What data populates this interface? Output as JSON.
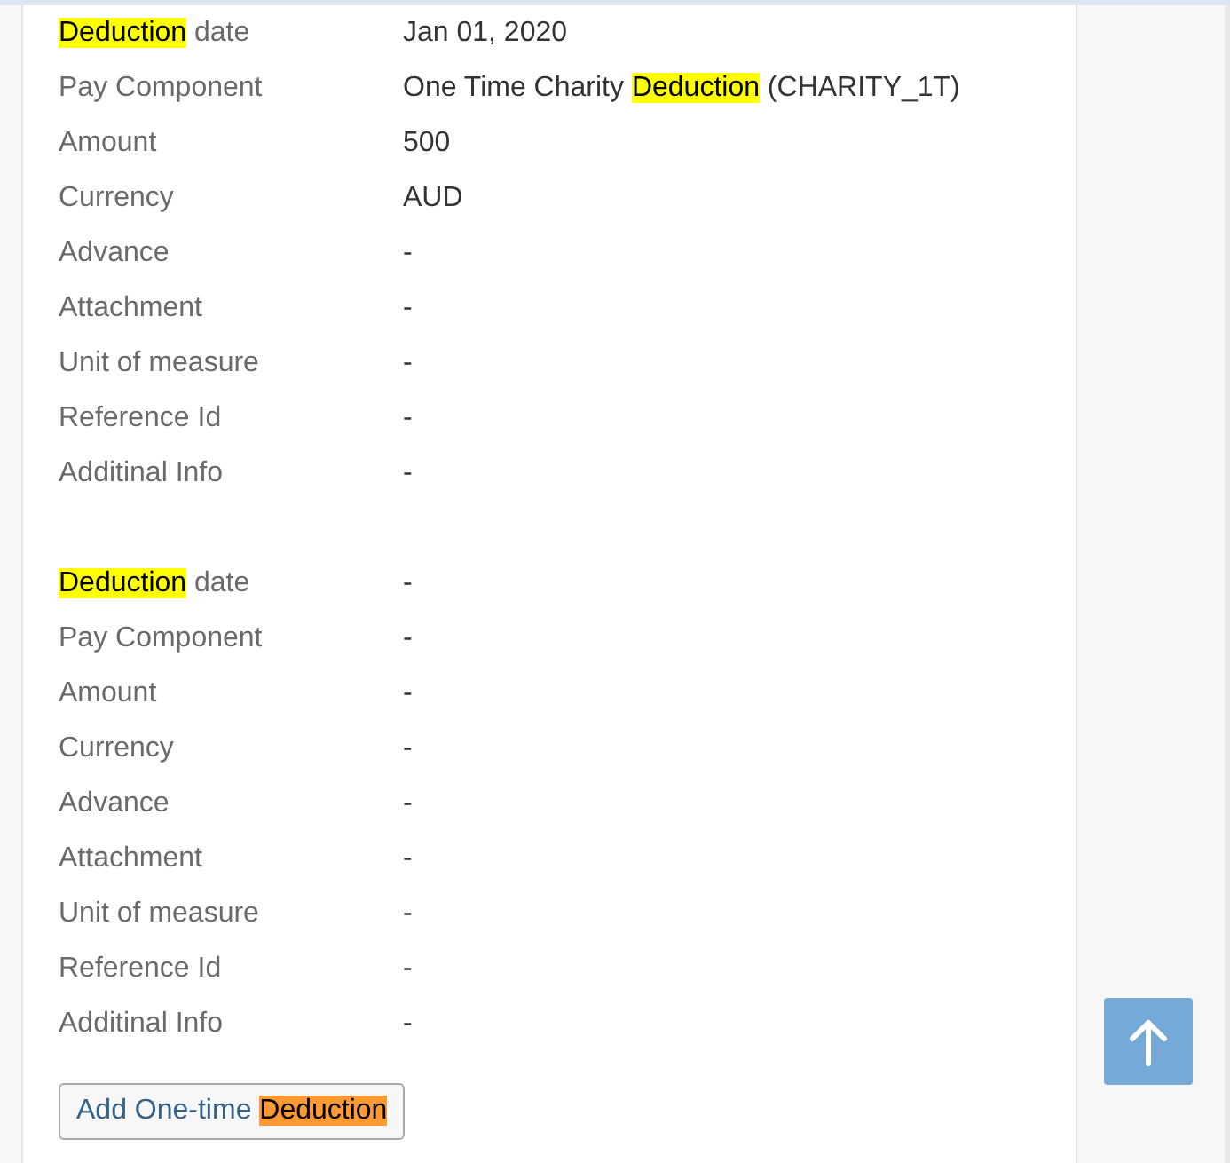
{
  "sections": [
    {
      "fields": [
        {
          "label": [
            {
              "text": "Deduction",
              "highlighted": true,
              "current": false
            },
            {
              "text": " date",
              "highlighted": false,
              "current": false
            }
          ],
          "value": [
            {
              "text": "Jan 01, 2020",
              "highlighted": false,
              "current": false
            }
          ]
        },
        {
          "label": [
            {
              "text": "Pay Component",
              "highlighted": false,
              "current": false
            }
          ],
          "value": [
            {
              "text": "One Time Charity ",
              "highlighted": false,
              "current": false
            },
            {
              "text": "Deduction",
              "highlighted": true,
              "current": false
            },
            {
              "text": " (CHARITY_1T)",
              "highlighted": false,
              "current": false
            }
          ]
        },
        {
          "label": [
            {
              "text": "Amount",
              "highlighted": false,
              "current": false
            }
          ],
          "value": [
            {
              "text": "500",
              "highlighted": false,
              "current": false
            }
          ]
        },
        {
          "label": [
            {
              "text": "Currency",
              "highlighted": false,
              "current": false
            }
          ],
          "value": [
            {
              "text": "AUD",
              "highlighted": false,
              "current": false
            }
          ]
        },
        {
          "label": [
            {
              "text": "Advance",
              "highlighted": false,
              "current": false
            }
          ],
          "value": [
            {
              "text": "-",
              "highlighted": false,
              "current": false
            }
          ]
        },
        {
          "label": [
            {
              "text": "Attachment",
              "highlighted": false,
              "current": false
            }
          ],
          "value": [
            {
              "text": "-",
              "highlighted": false,
              "current": false
            }
          ]
        },
        {
          "label": [
            {
              "text": "Unit of measure",
              "highlighted": false,
              "current": false
            }
          ],
          "value": [
            {
              "text": "-",
              "highlighted": false,
              "current": false
            }
          ]
        },
        {
          "label": [
            {
              "text": "Reference Id",
              "highlighted": false,
              "current": false
            }
          ],
          "value": [
            {
              "text": "-",
              "highlighted": false,
              "current": false
            }
          ]
        },
        {
          "label": [
            {
              "text": "Additinal Info",
              "highlighted": false,
              "current": false
            }
          ],
          "value": [
            {
              "text": "-",
              "highlighted": false,
              "current": false
            }
          ]
        }
      ]
    },
    {
      "fields": [
        {
          "label": [
            {
              "text": "Deduction",
              "highlighted": true,
              "current": false
            },
            {
              "text": " date",
              "highlighted": false,
              "current": false
            }
          ],
          "value": [
            {
              "text": "-",
              "highlighted": false,
              "current": false
            }
          ]
        },
        {
          "label": [
            {
              "text": "Pay Component",
              "highlighted": false,
              "current": false
            }
          ],
          "value": [
            {
              "text": "-",
              "highlighted": false,
              "current": false
            }
          ]
        },
        {
          "label": [
            {
              "text": "Amount",
              "highlighted": false,
              "current": false
            }
          ],
          "value": [
            {
              "text": "-",
              "highlighted": false,
              "current": false
            }
          ]
        },
        {
          "label": [
            {
              "text": "Currency",
              "highlighted": false,
              "current": false
            }
          ],
          "value": [
            {
              "text": "-",
              "highlighted": false,
              "current": false
            }
          ]
        },
        {
          "label": [
            {
              "text": "Advance",
              "highlighted": false,
              "current": false
            }
          ],
          "value": [
            {
              "text": "-",
              "highlighted": false,
              "current": false
            }
          ]
        },
        {
          "label": [
            {
              "text": "Attachment",
              "highlighted": false,
              "current": false
            }
          ],
          "value": [
            {
              "text": "-",
              "highlighted": false,
              "current": false
            }
          ]
        },
        {
          "label": [
            {
              "text": "Unit of measure",
              "highlighted": false,
              "current": false
            }
          ],
          "value": [
            {
              "text": "-",
              "highlighted": false,
              "current": false
            }
          ]
        },
        {
          "label": [
            {
              "text": "Reference Id",
              "highlighted": false,
              "current": false
            }
          ],
          "value": [
            {
              "text": "-",
              "highlighted": false,
              "current": false
            }
          ]
        },
        {
          "label": [
            {
              "text": "Additinal Info",
              "highlighted": false,
              "current": false
            }
          ],
          "value": [
            {
              "text": "-",
              "highlighted": false,
              "current": false
            }
          ]
        }
      ]
    }
  ],
  "add_button": {
    "label": [
      {
        "text": "Add One-time ",
        "highlighted": false,
        "current": false
      },
      {
        "text": "Deduction",
        "highlighted": true,
        "current": true
      }
    ]
  }
}
